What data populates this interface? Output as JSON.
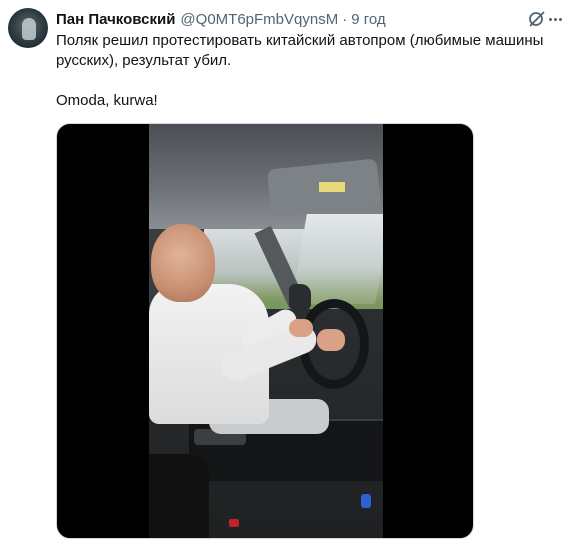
{
  "tweet": {
    "author_name": "Пан Пачковский",
    "author_handle": "@Q0MT6pFmbVqynsM",
    "separator": "·",
    "timestamp": "9 год",
    "text_line_1": "Поляк решил протестировать китайский автопром (любимые машины русских), результат убил.",
    "text_line_2": "Omoda, kurwa!"
  },
  "icons": {
    "avatar": "avatar",
    "action": "grok-icon",
    "more": "more-icon"
  },
  "colors": {
    "text": "#0f1419",
    "secondary": "#536471",
    "media_border": "#cfd9de"
  }
}
